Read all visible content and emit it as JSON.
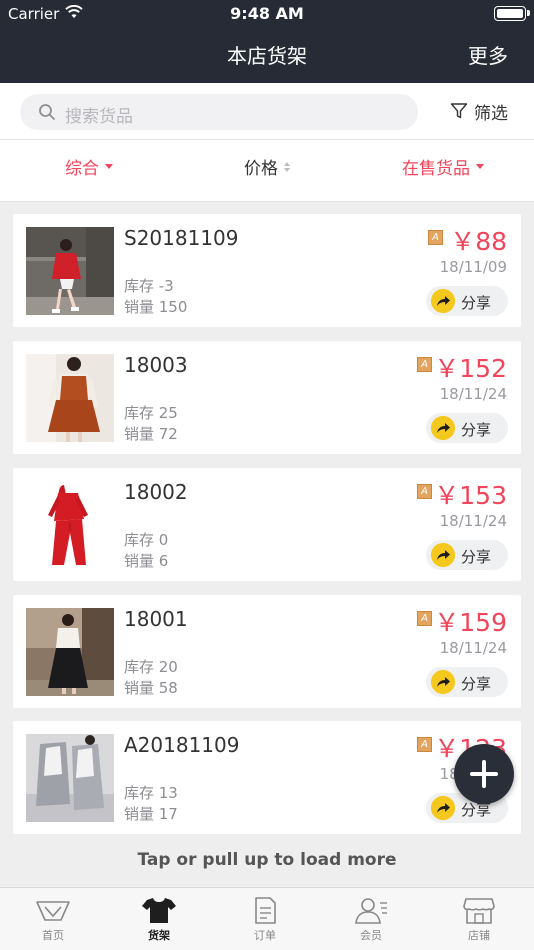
{
  "status_bar": {
    "carrier": "Carrier",
    "time": "9:48 AM"
  },
  "header": {
    "title": "本店货架",
    "more": "更多"
  },
  "search": {
    "placeholder": "搜索货品",
    "filter_label": "筛选"
  },
  "sort_bar": {
    "comprehensive": "综合",
    "price": "价格",
    "status": "在售货品"
  },
  "products": [
    {
      "name": "S20181109",
      "stock_label": "库存 -3",
      "sales_label": "销量 150",
      "price": "￥88",
      "date": "18/11/09",
      "share": "分享",
      "badge": "A",
      "thumb": "red-outfit-photo"
    },
    {
      "name": "18003",
      "stock_label": "库存 25",
      "sales_label": "销量 72",
      "price": "￥152",
      "date": "18/11/24",
      "share": "分享",
      "badge": "A",
      "thumb": "brown-dress-photo"
    },
    {
      "name": "18002",
      "stock_label": "库存 0",
      "sales_label": "销量 6",
      "price": "￥153",
      "date": "18/11/24",
      "share": "分享",
      "badge": "A",
      "thumb": "red-tracksuit-photo"
    },
    {
      "name": "18001",
      "stock_label": "库存 20",
      "sales_label": "销量 58",
      "price": "￥159",
      "date": "18/11/24",
      "share": "分享",
      "badge": "A",
      "thumb": "black-skirt-photo"
    },
    {
      "name": "A20181109",
      "stock_label": "库存 13",
      "sales_label": "销量 17",
      "price": "￥123",
      "date": "18/11/24",
      "share": "分享",
      "badge": "A",
      "thumb": "grey-coat-photo"
    }
  ],
  "load_more": "Tap or pull up to load more",
  "tabs": [
    {
      "label": "首页",
      "icon": "home-icon",
      "active": false
    },
    {
      "label": "货架",
      "icon": "tshirt-icon",
      "active": true
    },
    {
      "label": "订单",
      "icon": "order-icon",
      "active": false
    },
    {
      "label": "会员",
      "icon": "member-icon",
      "active": false
    },
    {
      "label": "店铺",
      "icon": "store-icon",
      "active": false
    }
  ],
  "colors": {
    "header_bg": "#262b36",
    "accent": "#f0455b",
    "share_icon": "#f5c81d"
  }
}
